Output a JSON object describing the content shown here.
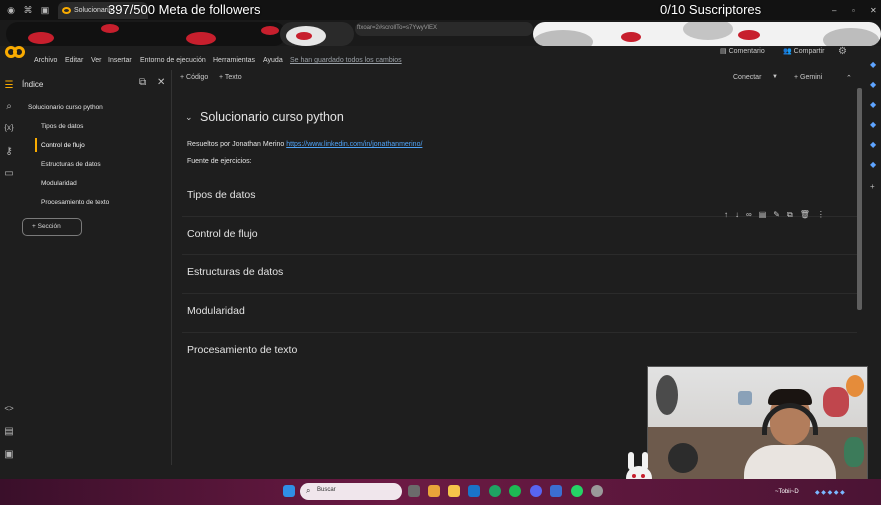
{
  "overlay": {
    "followers": "397/500 Meta de followers",
    "subscribers": "0/10 Suscriptores"
  },
  "browser": {
    "tab_title": "Solucionario",
    "url_fragment": "ftxoar=2#scrollTo=s7YwyVlEX"
  },
  "menu": {
    "items": [
      "Archivo",
      "Editar",
      "Ver",
      "Insertar",
      "Entorno de ejecución",
      "Herramientas",
      "Ayuda"
    ],
    "saved_status": "Se han guardado todos los cambios",
    "comment": "Comentario",
    "share": "Compartir"
  },
  "toolbar": {
    "add_code": "+ Código",
    "add_text": "+ Texto",
    "connect": "Conectar",
    "gemini": "+ Gemini"
  },
  "toc": {
    "title": "Índice",
    "items": [
      "Solucionario curso python",
      "Tipos de datos",
      "Control de flujo",
      "Estructuras de datos",
      "Modularidad",
      "Procesamiento de texto"
    ],
    "active_index": 2,
    "section_button": "Sección"
  },
  "notebook": {
    "title": "Solucionario curso python",
    "author_prefix": "Resueltos por Jonathan Merino",
    "author_link": "https://www.linkedin.com/in/jonathanmerino/",
    "sources_label": "Fuente de ejercicios:",
    "sections": [
      "Tipos de datos",
      "Control de flujo",
      "Estructuras de datos",
      "Modularidad",
      "Procesamiento de texto"
    ]
  },
  "taskbar": {
    "search_placeholder": "Buscar",
    "tray_text": "~Tobii~D"
  }
}
